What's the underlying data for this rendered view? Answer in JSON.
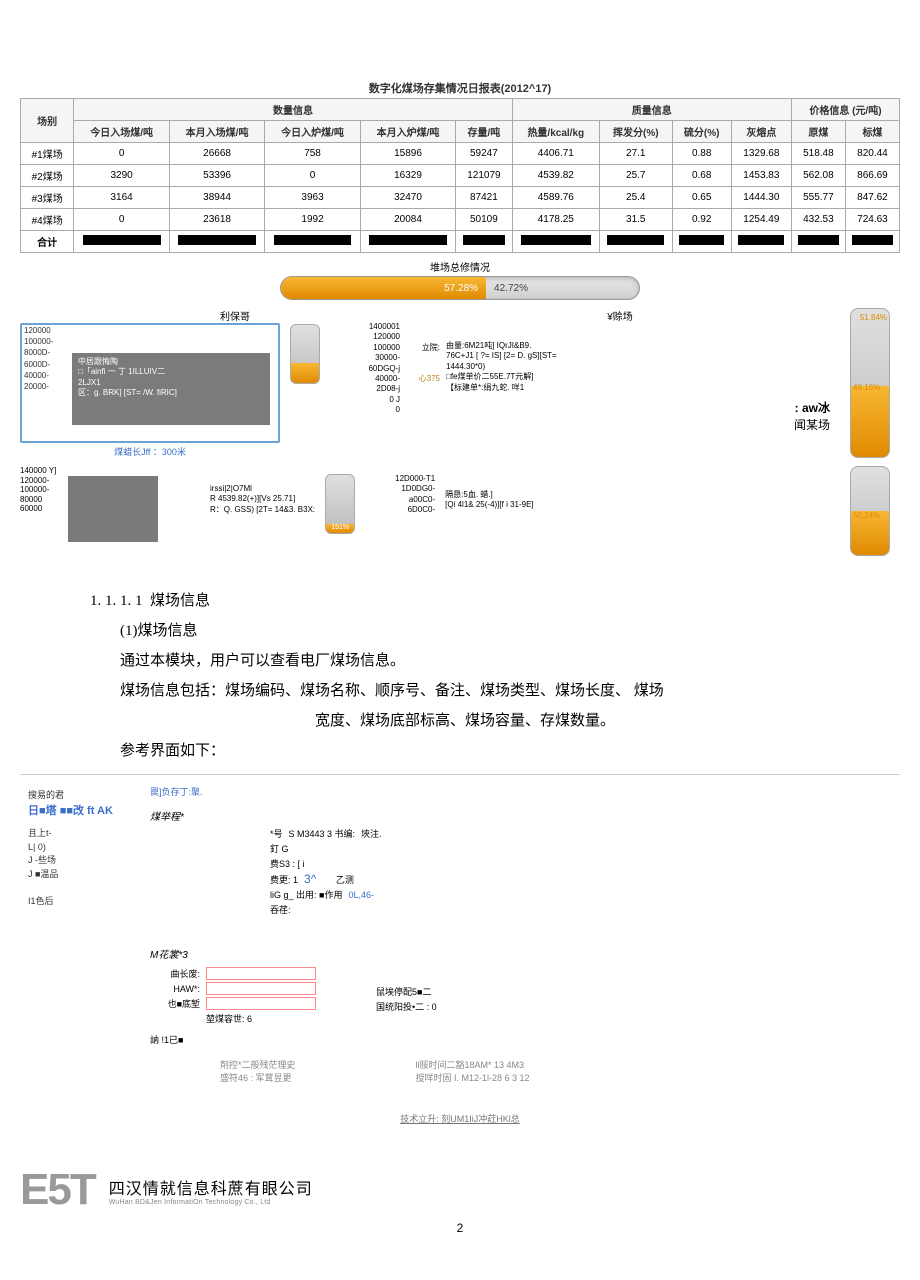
{
  "report": {
    "title": "数字化煤场存集情况日报表(2012^17)",
    "header_groups": {
      "qty": "数量信息",
      "qual": "质量信息",
      "price": "价格信息 (元/吨)"
    },
    "cols": [
      "场别",
      "今日入场煤/吨",
      "本月入场煤/吨",
      "今日入炉煤/吨",
      "本月入炉煤/吨",
      "存量/吨",
      "热量/kcal/kg",
      "挥发分(%)",
      "硫分(%)",
      "灰熔点",
      "原煤",
      "标煤"
    ],
    "rows": [
      [
        "#1煤场",
        "0",
        "26668",
        "758",
        "15896",
        "59247",
        "4406.71",
        "27.1",
        "0.88",
        "1329.68",
        "518.48",
        "820.44"
      ],
      [
        "#2煤场",
        "3290",
        "53396",
        "0",
        "16329",
        "121079",
        "4539.82",
        "25.7",
        "0.68",
        "1453.83",
        "562.08",
        "866.69"
      ],
      [
        "#3煤场",
        "3164",
        "38944",
        "3963",
        "32470",
        "87421",
        "4589.76",
        "25.4",
        "0.65",
        "1444.30",
        "555.77",
        "847.62"
      ],
      [
        "#4煤场",
        "0",
        "23618",
        "1992",
        "20084",
        "50109",
        "4178.25",
        "31.5",
        "0.92",
        "1254.49",
        "432.53",
        "724.63"
      ]
    ],
    "sum_label": "合计"
  },
  "pipe": {
    "title": "堆场总修情况",
    "left_pct": "57.28%",
    "right_pct": "42.72%"
  },
  "chart1": {
    "title_left": "利保哥",
    "title_right": "¥赊场",
    "yticks": [
      "120000",
      "100000-",
      "8000D-",
      "6000D-",
      "40000-",
      "20000-"
    ],
    "inner_lines": [
      "中居跟悔陶",
      "□「ainfi 一 丁 1ILLUIV二",
      "2LJX1",
      "区：g. BRK] [ST= /W. fiRIC]"
    ],
    "caption": "煤蜡长Jff ：300米",
    "right_y": [
      "1400001",
      "120000",
      "100000",
      "30000-",
      "60DGQ-j",
      "40000-",
      "2D08-j",
      "0 J",
      "0"
    ],
    "right_text": [
      "由量:6M21吨]   IQrJI&B9.",
      "76C+J1 [ ?= IS] [2= D. gS][ST=",
      "1444.30*0)",
      "□fe煤单价二55E.7T元解]",
      "【标建单*:绢九蛇. 咩1"
    ],
    "right_mid": "心375",
    "right_leftlabel": "立院:",
    "aw": ": aw冰",
    "sub": "闻某场"
  },
  "chart2": {
    "y": [
      "140000 Y]",
      "120000-",
      "100000-",
      "80000",
      "60000"
    ],
    "text": [
      "irssi|2|O7Ml",
      "R 4539.82(+)][Vs 25.71]",
      "R：Q. GSS) [2T= 14&3. B3X:"
    ],
    "right_y": [
      "12D000-T1",
      "1D0DG0-",
      "a00C0-",
      "6D0C0-"
    ],
    "right_text": [
      "隔恳:5血. 蜡.]",
      "[Qi 4l1& 25(-4)][f i 31-9E]"
    ]
  },
  "cylinders": {
    "c1_top": "51.84%",
    "c1_mid": "49.16%",
    "c2_mid": "50.24%",
    "small1": "151%"
  },
  "doc": {
    "h_num": "1. 1. 1. 1",
    "h_title": "煤场信息",
    "s1": "(1)煤场信息",
    "p1": "通过本模块，用户可以查看电厂煤场信息。",
    "p2": "煤场信息包括：煤场编码、煤场名称、顺序号、备注、煤场类型、煤场长度、 煤场",
    "p2b": "宽度、煤场底部标高、煤场容量、存煤数量。",
    "p3": "参考界面如下：",
    "search_label": "搜易的君",
    "toolbar": "日■塔 ■■改 ft AK",
    "tree": [
      "且上t-",
      "L| 0)",
      "J -些场",
      "J ■温品",
      "",
      "I1色后"
    ],
    "form_top": "罠]负存丁:聚.",
    "fieldset1_title": "煤举程*",
    "f1": {
      "code_label": "*号",
      "code": "S M3443 3 书编:",
      "note_label": "埉注.",
      "f2": "釘 G",
      "f3": "费S3 : [ i",
      "f4": "费更: 1",
      "f4v": "3^",
      "f4r": "乙测",
      "f5": "liG g_ 出用: ■作用",
      "f5v": "0L,46-",
      "f6": "吞荏:"
    },
    "fieldset2_title": "M花裳*3",
    "f2set": {
      "l1": "曲长废:",
      "l2": "HAW*:",
      "l3": "也■底堑",
      "l4": "堃煤容世: 6",
      "r1": "鼠埃停配5■二",
      "r2": "国统阳投•二 : 0",
      "b1": "訥 !1已■",
      "b2": "剤控*二般残茫理史",
      "b3": "盛符46 : 军茸昱更",
      "b4": "ll脮时间二豁18AM* 13 4M3",
      "b5": "授咩时固 I. M12-1l-28 6 3 12"
    },
    "bottom_link": "技术立升: 刻UM1IiJ冲荭HKl总"
  },
  "footer": {
    "logo": "E5T",
    "zh": "四汉情就信息科蔗有眼公司",
    "en": "WuHan BD&Jen InformatiOn Technology Co., Ltd",
    "page": "2"
  }
}
